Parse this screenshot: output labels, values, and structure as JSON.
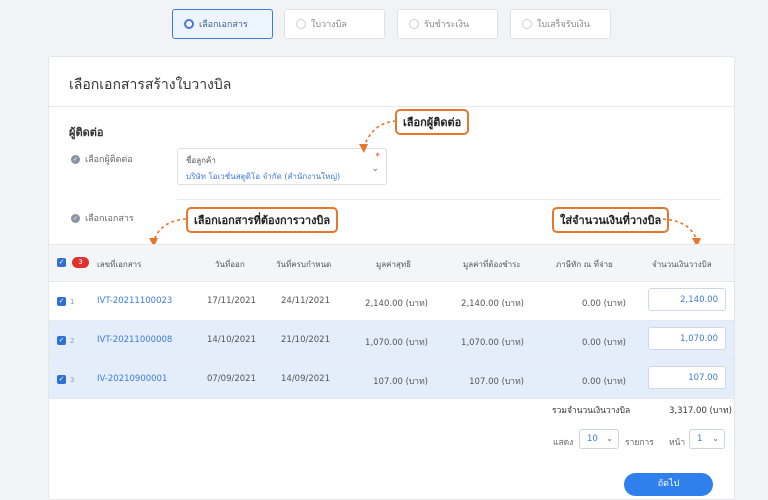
{
  "steps": [
    {
      "label": "เลือกเอกสาร"
    },
    {
      "label": "ใบวางบิล"
    },
    {
      "label": "รับชำระเงิน"
    },
    {
      "label": "ใบเสร็จรับเงิน"
    }
  ],
  "card": {
    "title": "เลือกเอกสารสร้างใบวางบิล",
    "section_title": "ผู้ติดต่อ",
    "contact_check_label": "เลือกผู้ติดต่อ",
    "docs_check_label": "เลือกเอกสาร"
  },
  "client_select": {
    "label": "ชื่อลูกค้า",
    "value": "บริษัท โอเวชั่นสตูดิโอ จำกัด (สำนักงานใหญ่)",
    "required_mark": "*"
  },
  "callouts": {
    "choose_contact": "เลือกผู้ติดต่อ",
    "choose_docs": "เลือกเอกสารที่ต้องการวางบิล",
    "enter_amount": "ใส่จำนวนเงินที่วางบิล"
  },
  "table": {
    "selected_count": "3",
    "headers": {
      "doc_no": "เลขที่เอกสาร",
      "issue_date": "วันที่ออก",
      "due_date": "วันที่ครบกำหนด",
      "net": "มูลค่าสุทธิ",
      "to_pay": "มูลค่าที่ต้องชำระ",
      "withholding": "ภาษีหัก ณ ที่จ่าย",
      "bill_amount": "จำนวนเงินวางบิล"
    },
    "rows": [
      {
        "num": "1",
        "doc_no": "IVT-20211100023",
        "issue_date": "17/11/2021",
        "due_date": "24/11/2021",
        "net": "2,140.00 (บาท)",
        "to_pay": "2,140.00 (บาท)",
        "withholding": "0.00 (บาท)",
        "amount": "2,140.00"
      },
      {
        "num": "2",
        "doc_no": "IVT-20211000008",
        "issue_date": "14/10/2021",
        "due_date": "21/10/2021",
        "net": "1,070.00 (บาท)",
        "to_pay": "1,070.00 (บาท)",
        "withholding": "0.00 (บาท)",
        "amount": "1,070.00"
      },
      {
        "num": "3",
        "doc_no": "IV-20210900001",
        "issue_date": "07/09/2021",
        "due_date": "14/09/2021",
        "net": "107.00 (บาท)",
        "to_pay": "107.00 (บาท)",
        "withholding": "0.00 (บาท)",
        "amount": "107.00"
      }
    ],
    "total_label": "รวมจำนวนเงินวางบิล",
    "total_value": "3,317.00 (บาท)"
  },
  "pager": {
    "show_label": "แสดง",
    "page_size": "10",
    "items_label": "รายการ",
    "page_label": "หน้า",
    "page": "1"
  },
  "next_button": "ถัดไป",
  "colors": {
    "accent": "#2f80ed",
    "callout_border": "#e8772e",
    "selected_row": "#e4eefb",
    "badge": "#e0302c"
  },
  "icons": {
    "check": "check-circle-icon",
    "chevron": "chevron-down-icon"
  }
}
